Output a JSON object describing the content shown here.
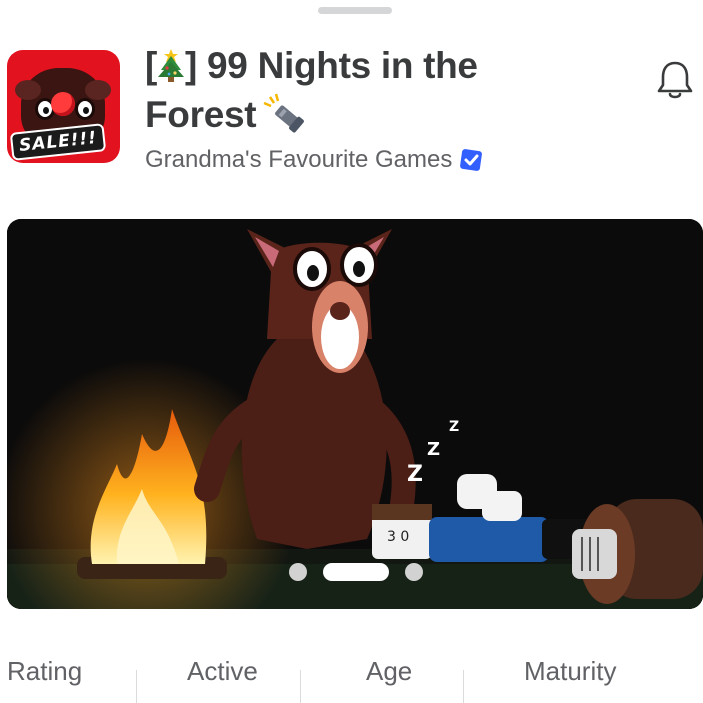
{
  "header": {
    "title_prefix": "[",
    "title_suffix": "] 99 Nights in the",
    "title_line2": "Forest",
    "creator": "Grandma's Favourite Games",
    "icon_badge_text": "SALE!!!"
  },
  "icons": {
    "title_emoji_1": "christmas-tree-icon",
    "title_emoji_2": "flashlight-icon",
    "creator_badge": "verified-badge-icon",
    "notify": "bell-icon"
  },
  "carousel": {
    "slides": 3,
    "active_slide": 2
  },
  "stats": {
    "labels": [
      "Rating",
      "Active",
      "Age",
      "Maturity"
    ]
  },
  "colors": {
    "verified_blue": "#335fff",
    "icon_red": "#e3121f"
  }
}
